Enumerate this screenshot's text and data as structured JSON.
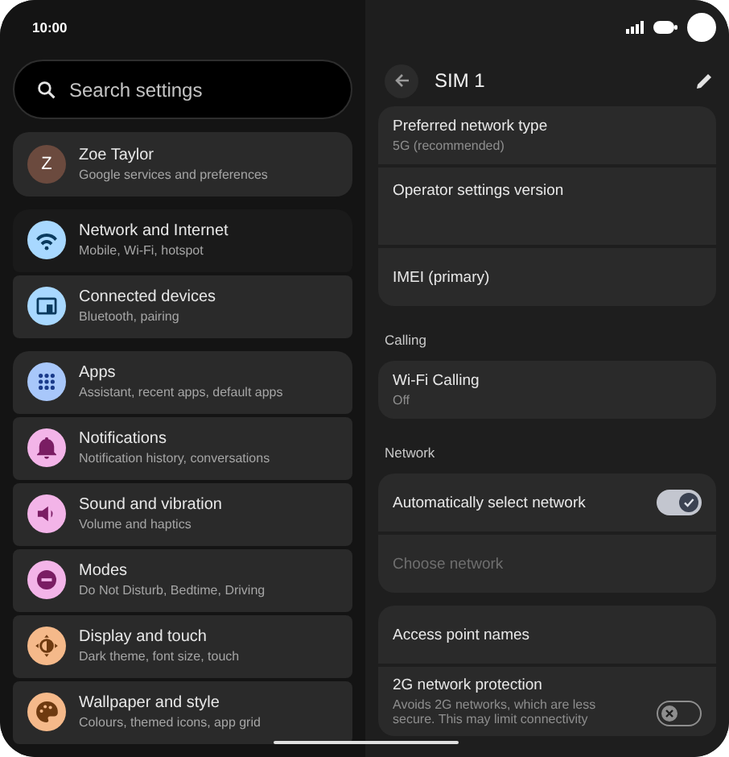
{
  "status_bar": {
    "time": "10:00"
  },
  "search": {
    "placeholder": "Search settings"
  },
  "account": {
    "initial": "Z",
    "name": "Zoe Taylor",
    "subtitle": "Google services and preferences",
    "color": "#6b4a3e"
  },
  "settings_groups": [
    [
      {
        "title": "Network and Internet",
        "subtitle": "Mobile, Wi-Fi, hotspot",
        "color": "#a8d8ff",
        "selected": true
      },
      {
        "title": "Connected devices",
        "subtitle": "Bluetooth, pairing",
        "color": "#a8d8ff",
        "selected": false
      }
    ],
    [
      {
        "title": "Apps",
        "subtitle": "Assistant, recent apps, default apps",
        "color": "#a8c7fa",
        "selected": false
      },
      {
        "title": "Notifications",
        "subtitle": "Notification history, conversations",
        "color": "#f3b4e8",
        "selected": false
      },
      {
        "title": "Sound and vibration",
        "subtitle": "Volume and haptics",
        "color": "#f3b4e8",
        "selected": false
      },
      {
        "title": "Modes",
        "subtitle": "Do Not Disturb, Bedtime, Driving",
        "color": "#f3b4e8",
        "selected": false
      },
      {
        "title": "Display and touch",
        "subtitle": "Dark theme, font size, touch",
        "color": "#f5b98a",
        "selected": false
      },
      {
        "title": "Wallpaper and style",
        "subtitle": "Colours, themed icons, app grid",
        "color": "#f5b98a",
        "selected": false
      }
    ]
  ],
  "detail": {
    "title": "SIM 1",
    "sections": [
      {
        "rows": [
          {
            "kind": "text",
            "title": "Preferred network type",
            "subtitle": "5G (recommended)",
            "disabled": false,
            "tall": false
          },
          {
            "kind": "text",
            "title": "Operator settings version",
            "disabled": false,
            "tall": true
          },
          {
            "kind": "text",
            "title": "IMEI (primary)",
            "disabled": false,
            "tall": false
          }
        ]
      },
      {
        "label": "Calling",
        "rows": [
          {
            "kind": "text",
            "title": "Wi-Fi Calling",
            "subtitle": "Off",
            "disabled": false,
            "tall": false
          }
        ]
      },
      {
        "label": "Network",
        "rows": [
          {
            "kind": "toggle",
            "title": "Automatically select network",
            "on": true,
            "disabled": false,
            "tall": false
          },
          {
            "kind": "text",
            "title": "Choose network",
            "disabled": true,
            "tall": false
          }
        ]
      },
      {
        "rows": [
          {
            "kind": "text",
            "title": "Access point names",
            "disabled": false,
            "tall": false
          },
          {
            "kind": "toggle",
            "title": "2G network protection",
            "subtitle": "Avoids 2G networks, which are less secure. This may limit connectivity",
            "on": false,
            "disabled": false,
            "tall": false
          }
        ]
      }
    ]
  }
}
